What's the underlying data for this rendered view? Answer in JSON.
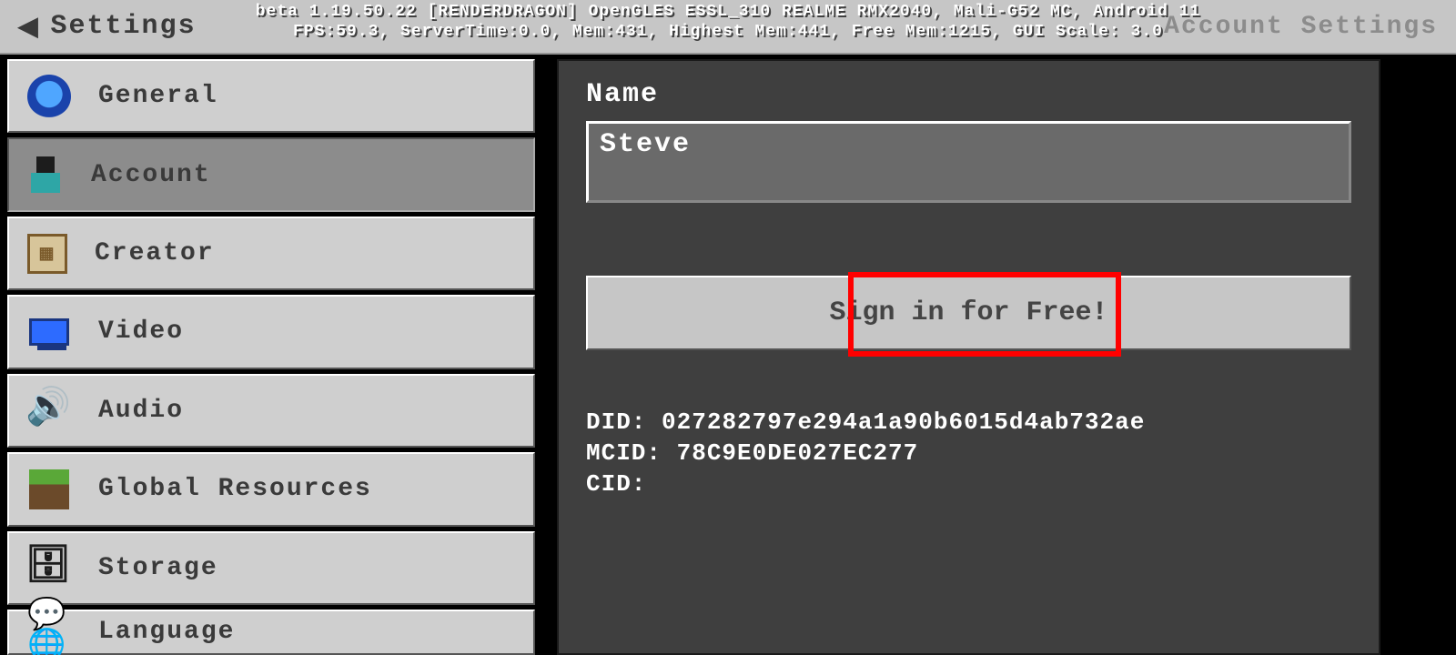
{
  "header": {
    "title": "Settings",
    "right": "Account Settings",
    "debug_line1": "beta 1.19.50.22 [RENDERDRAGON] OpenGLES ESSL_310 REALME RMX2040, Mali-G52 MC, Android 11",
    "debug_line2": "FPS:59.3, ServerTime:0.0, Mem:431, Highest Mem:441, Free Mem:1215, GUI Scale: 3.0"
  },
  "sidebar": {
    "items": [
      {
        "label": "General"
      },
      {
        "label": "Account"
      },
      {
        "label": "Creator"
      },
      {
        "label": "Video"
      },
      {
        "label": "Audio"
      },
      {
        "label": "Global Resources"
      },
      {
        "label": "Storage"
      },
      {
        "label": "Language"
      }
    ]
  },
  "content": {
    "name_label": "Name",
    "name_value": "Steve",
    "signin_label": "Sign in for Free!",
    "did_label": "DID:",
    "did_value": "027282797e294a1a90b6015d4ab732ae",
    "mcid_label": "MCID:",
    "mcid_value": "78C9E0DE027EC277",
    "cid_label": "CID:",
    "cid_value": ""
  }
}
